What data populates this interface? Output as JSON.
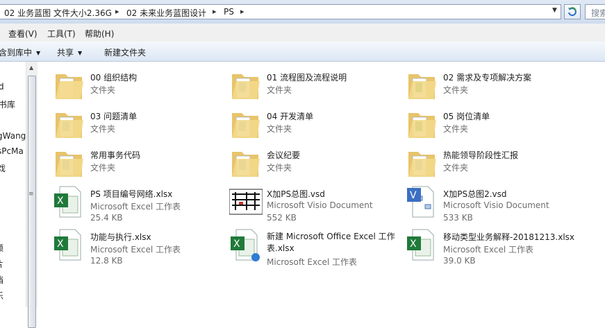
{
  "address": {
    "crumbs": [
      "02 业务蓝图 文件大小2.36G",
      "02 未来业务蓝图设计",
      "PS"
    ],
    "sep": "▸",
    "search_placeholder": "搜索"
  },
  "menu": [
    "查看(V)",
    "工具(T)",
    "帮助(H)"
  ],
  "toolbar": {
    "include_library": "包含到库中",
    "share": "共享",
    "new_folder": "新建文件夹"
  },
  "nav": [
    "d",
    "书库",
    "gWang",
    "sPcMa",
    "戏",
    "频",
    "片",
    "档",
    "乐"
  ],
  "items": [
    {
      "name": "00 组织结构",
      "type": "文件夹",
      "size": "",
      "icon": "folder-icon"
    },
    {
      "name": "01 流程图及流程说明",
      "type": "文件夹",
      "size": "",
      "icon": "folder-icon"
    },
    {
      "name": "02 需求及专项解决方案",
      "type": "文件夹",
      "size": "",
      "icon": "folder-icon"
    },
    {
      "name": "03 问题清单",
      "type": "文件夹",
      "size": "",
      "icon": "folder-icon"
    },
    {
      "name": "04 开发清单",
      "type": "文件夹",
      "size": "",
      "icon": "folder-icon"
    },
    {
      "name": "05 岗位清单",
      "type": "文件夹",
      "size": "",
      "icon": "folder-icon"
    },
    {
      "name": "常用事务代码",
      "type": "文件夹",
      "size": "",
      "icon": "folder-icon"
    },
    {
      "name": "会议纪要",
      "type": "文件夹",
      "size": "",
      "icon": "folder-icon"
    },
    {
      "name": "热能领导阶段性汇报",
      "type": "文件夹",
      "size": "",
      "icon": "folder-icon"
    },
    {
      "name": "PS 项目编号网络.xlsx",
      "type": "Microsoft Excel 工作表",
      "size": "25.4 KB",
      "icon": "excel-file-icon"
    },
    {
      "name": "X加PS总图.vsd",
      "type": "Microsoft Visio Document",
      "size": "552 KB",
      "icon": "visio-thumbnail-icon"
    },
    {
      "name": "X加PS总图2.vsd",
      "type": "Microsoft Visio Document",
      "size": "533 KB",
      "icon": "visio-file-icon"
    },
    {
      "name": "功能与执行.xlsx",
      "type": "Microsoft Excel 工作表",
      "size": "12.8 KB",
      "icon": "excel-file-icon"
    },
    {
      "name": "新建 Microsoft Office Excel 工作表.xlsx",
      "type": "Microsoft Excel 工作表",
      "size": "",
      "icon": "excel-file-icon"
    },
    {
      "name": "移动类型业务解释-20181213.xlsx",
      "type": "Microsoft Excel 工作表",
      "size": "39.0 KB",
      "icon": "excel-file-icon"
    }
  ]
}
